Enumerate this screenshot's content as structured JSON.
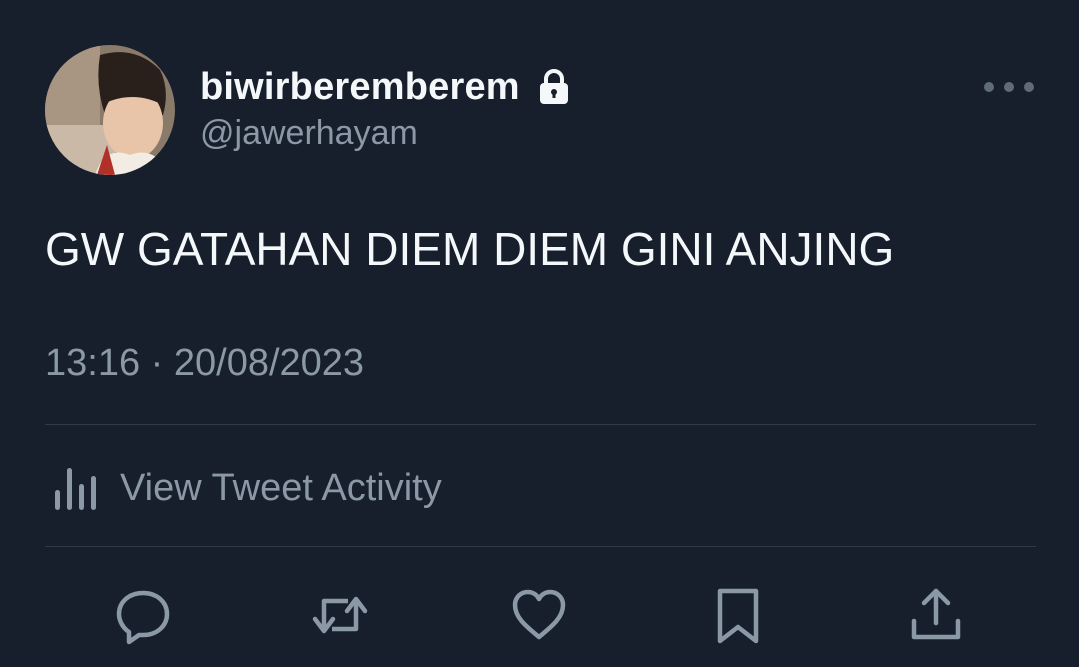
{
  "user": {
    "display_name": "biwirberemberem",
    "handle": "@jawerhayam",
    "protected_icon": "lock-icon",
    "avatar": "profile-photo"
  },
  "tweet": {
    "text": "GW GATAHAN DIEM DIEM GINI ANJING",
    "timestamp": "13:16 · 20/08/2023"
  },
  "activity": {
    "label": "View Tweet Activity",
    "icon": "bar-chart-icon"
  },
  "actions": [
    {
      "name": "reply",
      "icon": "reply-icon"
    },
    {
      "name": "retweet",
      "icon": "retweet-icon"
    },
    {
      "name": "like",
      "icon": "heart-icon"
    },
    {
      "name": "bookmark",
      "icon": "bookmark-icon"
    },
    {
      "name": "share",
      "icon": "share-icon"
    }
  ],
  "colors": {
    "background": "#161f2b",
    "primary_text": "#f5f8fa",
    "secondary_text": "#8b98a5",
    "divider": "#2f3b47"
  }
}
